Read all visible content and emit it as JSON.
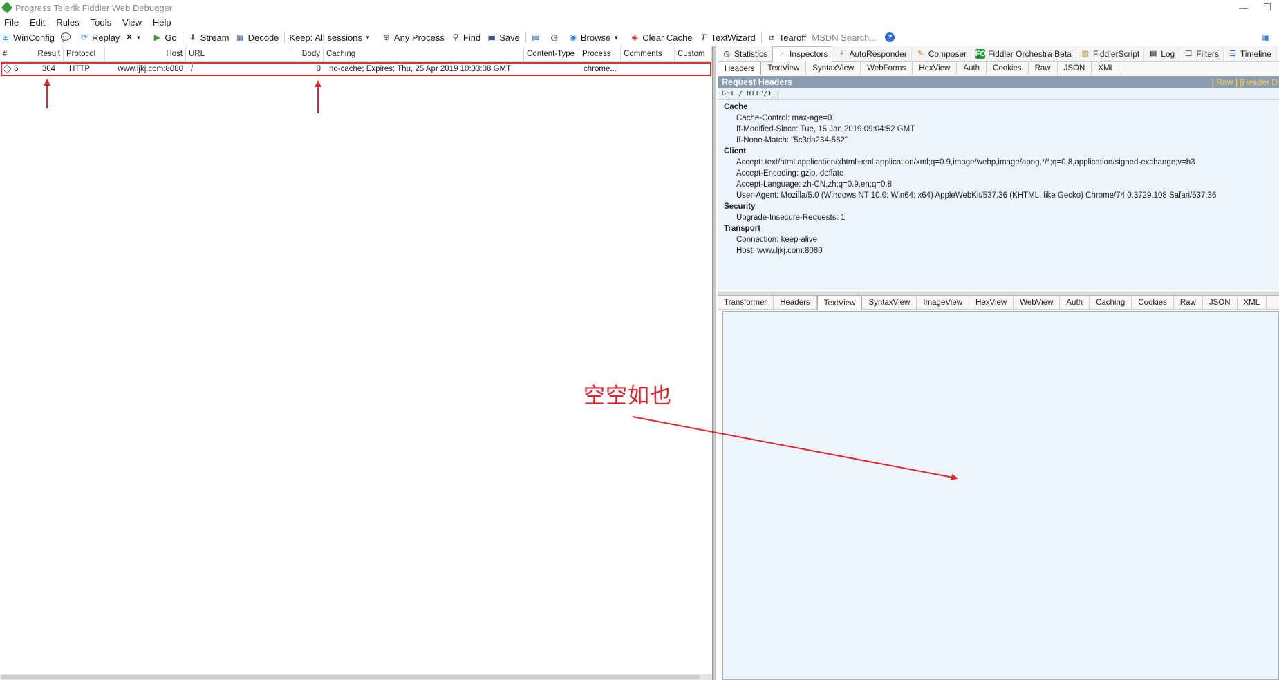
{
  "window": {
    "title": "Progress Telerik Fiddler Web Debugger",
    "minimize_glyph": "—",
    "restore_glyph": "❐"
  },
  "menu": [
    "File",
    "Edit",
    "Rules",
    "Tools",
    "View",
    "Help"
  ],
  "toolbar": {
    "winconfig": "WinConfig",
    "replay": "Replay",
    "remove": "✕",
    "go": "Go",
    "stream": "Stream",
    "decode": "Decode",
    "keep": "Keep: All sessions",
    "any_process": "Any Process",
    "find": "Find",
    "save": "Save",
    "browse": "Browse",
    "clear_cache": "Clear Cache",
    "textwizard": "TextWizard",
    "tearoff": "Tearoff",
    "msdn_search": "MSDN Search...",
    "help": "?"
  },
  "sessions": {
    "columns": [
      "#",
      "Result",
      "Protocol",
      "Host",
      "URL",
      "Body",
      "Caching",
      "Content-Type",
      "Process",
      "Comments",
      "Custom"
    ],
    "rows": [
      {
        "id": "6",
        "result": "304",
        "protocol": "HTTP",
        "host": "www.ljkj.com:8080",
        "url": "/",
        "body": "0",
        "caching": "no-cache; Expires: Thu, 25 Apr 2019 10:33:08 GMT",
        "content_type": "",
        "process": "chrome...",
        "comments": "",
        "custom": ""
      }
    ]
  },
  "inspector_tabs": [
    {
      "label": "Statistics",
      "icon": "clock-icon"
    },
    {
      "label": "Inspectors",
      "icon": "magnifier-icon"
    },
    {
      "label": "AutoResponder",
      "icon": "lightning-icon"
    },
    {
      "label": "Composer",
      "icon": "pencil-icon"
    },
    {
      "label": "Fiddler Orchestra Beta",
      "icon": "fo-icon"
    },
    {
      "label": "FiddlerScript",
      "icon": "script-icon"
    },
    {
      "label": "Log",
      "icon": "log-icon"
    },
    {
      "label": "Filters",
      "icon": "checkbox-icon"
    },
    {
      "label": "Timeline",
      "icon": "timeline-icon"
    }
  ],
  "fo_badge": "FO",
  "request_tabs": [
    "Headers",
    "TextView",
    "SyntaxView",
    "WebForms",
    "HexView",
    "Auth",
    "Cookies",
    "Raw",
    "JSON",
    "XML"
  ],
  "request": {
    "panel_title": "Request Headers",
    "panel_links": "[ Raw ]   [Header D",
    "request_line": "GET / HTTP/1.1",
    "groups": [
      {
        "name": "Cache",
        "headers": [
          "Cache-Control: max-age=0",
          "If-Modified-Since: Tue, 15 Jan 2019 09:04:52 GMT",
          "If-None-Match: \"5c3da234-562\""
        ]
      },
      {
        "name": "Client",
        "headers": [
          "Accept: text/html,application/xhtml+xml,application/xml;q=0.9,image/webp,image/apng,*/*;q=0.8,application/signed-exchange;v=b3",
          "Accept-Encoding: gzip, deflate",
          "Accept-Language: zh-CN,zh;q=0.9,en;q=0.8",
          "User-Agent: Mozilla/5.0 (Windows NT 10.0; Win64; x64) AppleWebKit/537.36 (KHTML, like Gecko) Chrome/74.0.3729.108 Safari/537.36"
        ]
      },
      {
        "name": "Security",
        "headers": [
          "Upgrade-Insecure-Requests: 1"
        ]
      },
      {
        "name": "Transport",
        "headers": [
          "Connection: keep-alive",
          "Host: www.ljkj.com:8080"
        ]
      }
    ]
  },
  "response_tabs": [
    "Transformer",
    "Headers",
    "TextView",
    "SyntaxView",
    "ImageView",
    "HexView",
    "WebView",
    "Auth",
    "Caching",
    "Cookies",
    "Raw",
    "JSON",
    "XML"
  ],
  "annotation": {
    "text": "空空如也",
    "color": "#e3262b"
  }
}
